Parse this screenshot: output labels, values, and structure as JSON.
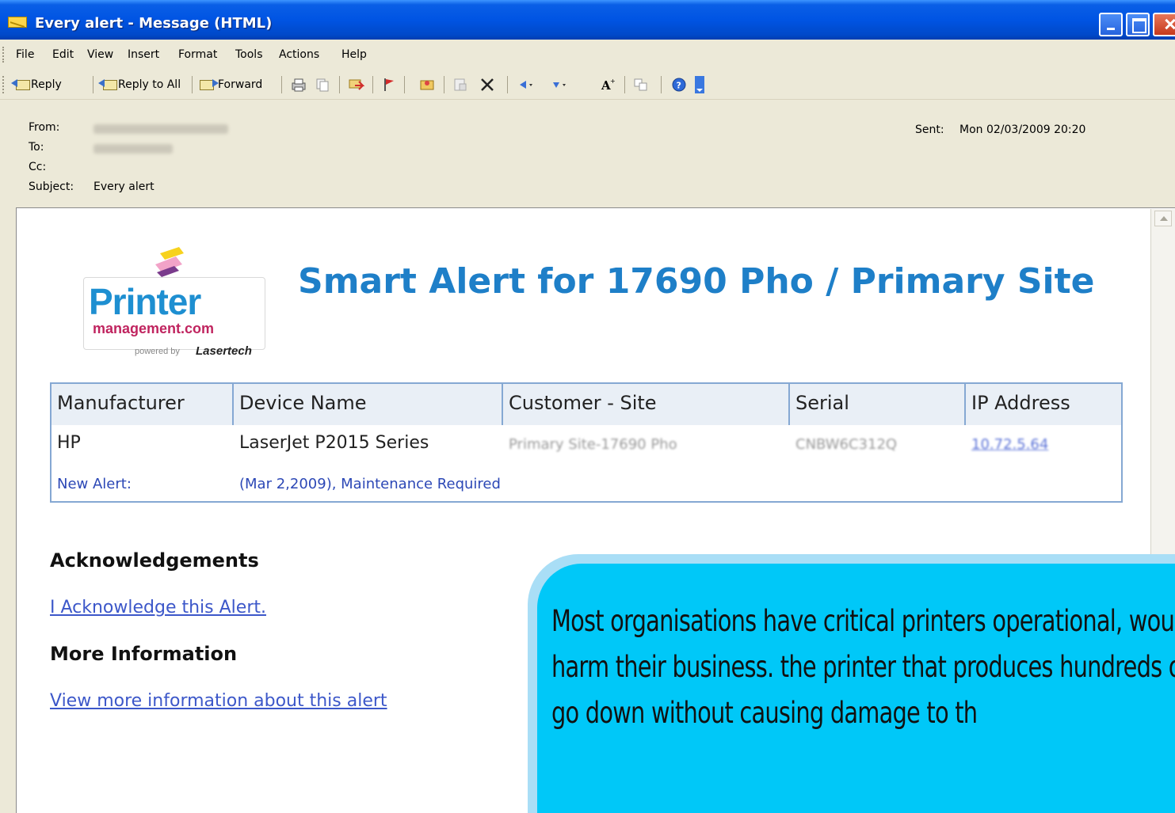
{
  "window": {
    "title": "Every alert - Message (HTML)",
    "title_icon": "envelope-icon"
  },
  "menubar": {
    "items": [
      "File",
      "Edit",
      "View",
      "Insert",
      "Format",
      "Tools",
      "Actions",
      "Help"
    ]
  },
  "toolbar": {
    "reply": "Reply",
    "reply_all": "Reply to All",
    "forward": "Forward",
    "icons": [
      "print-icon",
      "copy-icon",
      "move-folder-icon",
      "flag-icon",
      "address-book-icon",
      "junk-icon",
      "delete-icon",
      "previous-icon",
      "next-icon",
      "font-size-icon",
      "translate-icon",
      "help-icon",
      "toolbar-options-icon"
    ]
  },
  "header": {
    "from_label": "From:",
    "to_label": "To:",
    "cc_label": "Cc:",
    "subject_label": "Subject:",
    "subject_value": "Every alert",
    "sent_label": "Sent:",
    "sent_value": "Mon 02/03/2009 20:20"
  },
  "message": {
    "logo": {
      "word": "Printer",
      "sub": "management.com",
      "powered": "powered by",
      "brand": "Lasertech"
    },
    "alert_title": "Smart Alert for 17690 Pho / Primary Site",
    "table": {
      "headers": [
        "Manufacturer",
        "Device Name",
        "Customer - Site",
        "Serial",
        "IP Address"
      ],
      "row": [
        "HP",
        "LaserJet P2015 Series",
        "Primary Site-17690 Pho",
        "CNBW6C312Q",
        "10.72.5.64"
      ],
      "new_alert_label": "New Alert:",
      "new_alert_value": "(Mar 2,2009), Maintenance Required"
    },
    "ack_heading": "Acknowledgements",
    "ack_link": "I Acknowledge this Alert.",
    "more_heading": "More Information",
    "more_link": "View more information about this alert"
  },
  "callout": {
    "text": "Most organisations have critical printers operational, would harm their business. the printer that produces hundreds of i go down without causing damage to th"
  },
  "colors": {
    "title_blue": "#1e7fc8",
    "link_blue": "#3c57c9",
    "callout_cyan": "#00c8f8",
    "logo_pink": "#c0245f"
  }
}
